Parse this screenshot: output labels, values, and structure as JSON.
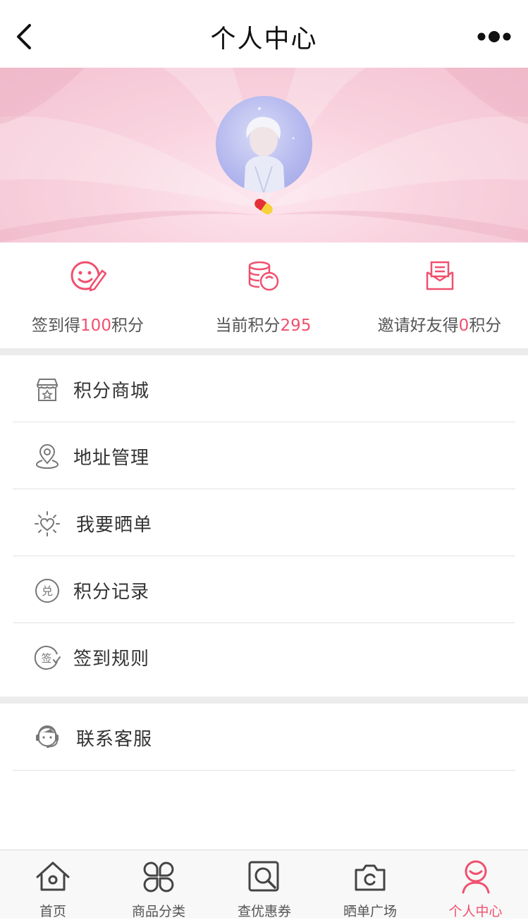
{
  "header": {
    "title": "个人中心"
  },
  "stats": [
    {
      "prefix": "签到得",
      "value": "100",
      "suffix": "积分"
    },
    {
      "prefix": "当前积分",
      "value": "295",
      "suffix": ""
    },
    {
      "prefix": "邀请好友得",
      "value": "0",
      "suffix": "积分"
    }
  ],
  "menu": [
    {
      "label": "积分商城",
      "icon": "store-icon"
    },
    {
      "label": "地址管理",
      "icon": "location-pin-icon"
    },
    {
      "label": "我要晒单",
      "icon": "sun-heart-icon"
    },
    {
      "label": "积分记录",
      "icon": "exchange-icon"
    },
    {
      "label": "签到规则",
      "icon": "sign-rule-icon"
    },
    {
      "label": "联系客服",
      "icon": "customer-service-icon"
    }
  ],
  "tabs": [
    {
      "label": "首页",
      "icon": "home-icon"
    },
    {
      "label": "商品分类",
      "icon": "category-icon"
    },
    {
      "label": "查优惠券",
      "icon": "coupon-search-icon"
    },
    {
      "label": "晒单广场",
      "icon": "camera-icon"
    },
    {
      "label": "个人中心",
      "icon": "profile-icon",
      "active": true
    }
  ],
  "colors": {
    "accent": "#f0506e",
    "banner": "#f6c9d6",
    "separator": "#ececec"
  }
}
